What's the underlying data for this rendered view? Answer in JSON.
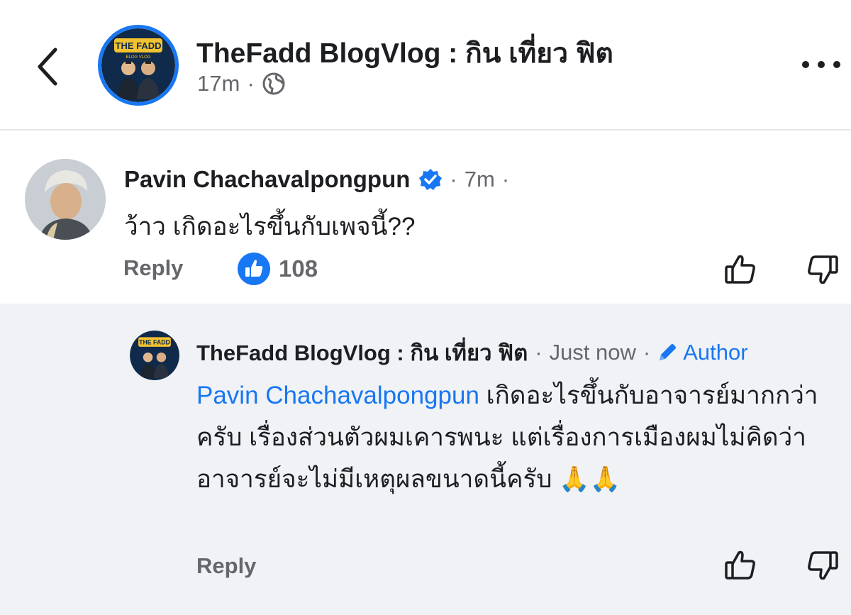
{
  "header": {
    "page_title": "TheFadd BlogVlog : กิน เที่ยว ฟิต",
    "time": "17m",
    "separator": "·",
    "privacy_icon": "globe-icon",
    "back_icon": "chevron-left-icon",
    "more_icon": "more-horizontal-icon",
    "avatar_logo_text": "THE FADD",
    "avatar_logo_sub": "BLOG VLOG"
  },
  "comment": {
    "author": "Pavin Chachavalpongpun",
    "verified_icon": "verified-badge-icon",
    "separator": "·",
    "time": "7m",
    "separator2": "·",
    "text": "ว้าว เกิดอะไรขึ้นกับเพจนี้??",
    "reply_label": "Reply",
    "like_icon": "like-reaction-icon",
    "like_count": "108",
    "upvote_icon": "thumbs-up-icon",
    "downvote_icon": "thumbs-down-icon"
  },
  "reply": {
    "author": "TheFadd BlogVlog : กิน เที่ยว ฟิต",
    "separator": "·",
    "time": "Just now",
    "separator2": "·",
    "author_badge_icon": "pencil-icon",
    "author_badge": "Author",
    "mention": "Pavin Chachavalpongpun",
    "text": " เกิดอะไรขึ้นกับอาจารย์มากกว่าครับ เรื่องส่วนตัวผมเคารพนะ แต่เรื่องการเมืองผมไม่คิดว่าอาจารย์จะไม่มีเหตุผลขนาดนี้ครับ ",
    "emoji": "🙏🙏",
    "reply_label": "Reply",
    "upvote_icon": "thumbs-up-icon",
    "downvote_icon": "thumbs-down-icon"
  },
  "colors": {
    "accent": "#1877f2",
    "secondary_text": "#65676b",
    "thread_bg": "#f0f2f5"
  }
}
